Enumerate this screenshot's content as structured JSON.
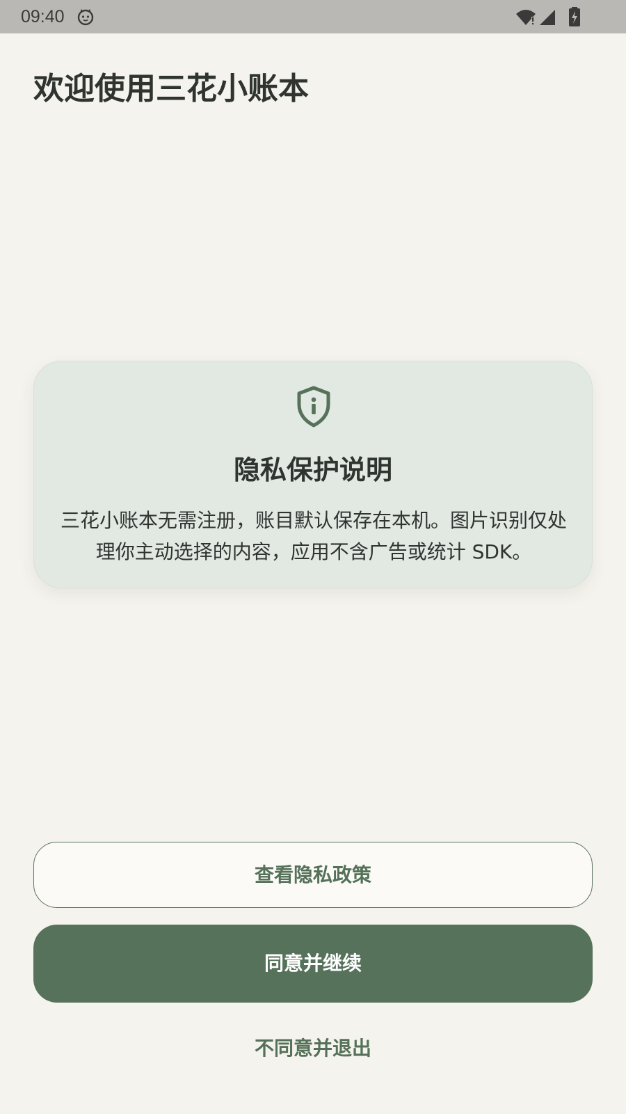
{
  "status_bar": {
    "time": "09:40",
    "notification_icon": "cat-face-icon",
    "wifi_icon": "wifi-warning-icon",
    "signal_icon": "cellular-signal-icon",
    "battery_icon": "battery-charging-icon"
  },
  "page": {
    "title": "欢迎使用三花小账本"
  },
  "privacy_card": {
    "icon": "shield-info-icon",
    "title": "隐私保护说明",
    "body": "三花小账本无需注册，账目默认保存在本机。图片识别仅处理你主动选择的内容，应用不含广告或统计 SDK。"
  },
  "actions": {
    "view_policy_label": "查看隐私政策",
    "agree_label": "同意并继续",
    "disagree_label": "不同意并退出"
  },
  "colors": {
    "background": "#f5f3ed",
    "card_background": "#e2e9e3",
    "accent": "#56725b",
    "text": "#2f3430"
  }
}
